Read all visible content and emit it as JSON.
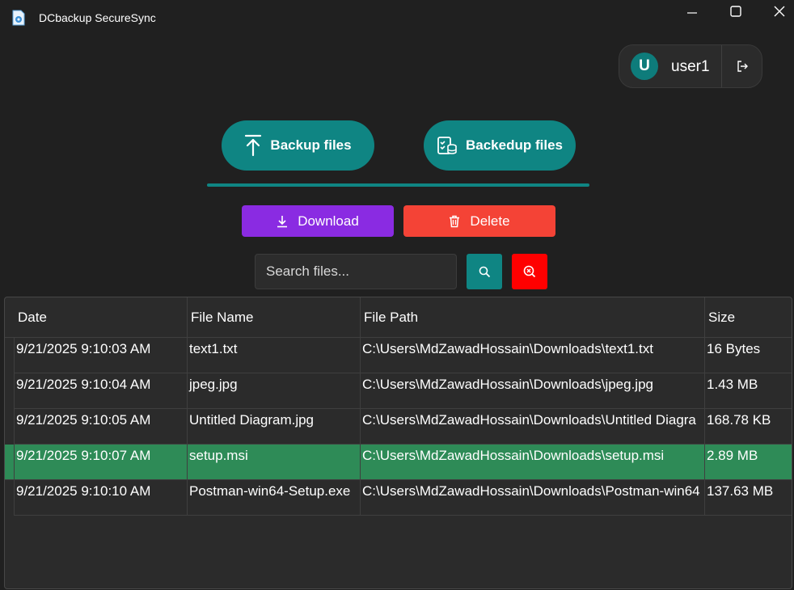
{
  "window": {
    "title": "DCbackup SecureSync"
  },
  "user": {
    "initial": "U",
    "name": "user1"
  },
  "tabs": [
    {
      "label": "Backup files",
      "icon": "upload-arrow-icon"
    },
    {
      "label": "Backedup files",
      "icon": "backed-up-files-icon"
    }
  ],
  "actions": {
    "download_label": "Download",
    "delete_label": "Delete"
  },
  "search": {
    "placeholder": "Search files...",
    "value": ""
  },
  "table": {
    "columns": [
      "Date",
      "File Name",
      "File Path",
      "Size"
    ],
    "rows": [
      {
        "date": "9/21/2025 9:10:03 AM",
        "name": "text1.txt",
        "path": "C:\\Users\\MdZawadHossain\\Downloads\\text1.txt",
        "size": "16 Bytes"
      },
      {
        "date": "9/21/2025 9:10:04 AM",
        "name": "jpeg.jpg",
        "path": "C:\\Users\\MdZawadHossain\\Downloads\\jpeg.jpg",
        "size": "1.43 MB"
      },
      {
        "date": "9/21/2025 9:10:05 AM",
        "name": "Untitled Diagram.jpg",
        "path": "C:\\Users\\MdZawadHossain\\Downloads\\Untitled Diagra",
        "size": "168.78 KB"
      },
      {
        "date": "9/21/2025 9:10:07 AM",
        "name": "setup.msi",
        "path": "C:\\Users\\MdZawadHossain\\Downloads\\setup.msi",
        "size": "2.89 MB"
      },
      {
        "date": "9/21/2025 9:10:10 AM",
        "name": "Postman-win64-Setup.exe",
        "path": "C:\\Users\\MdZawadHossain\\Downloads\\Postman-win64",
        "size": "137.63 MB"
      }
    ],
    "selected_row": 3
  },
  "colors": {
    "background": "#202020",
    "teal": "#0f8583",
    "purple": "#8a2be2",
    "red": "#f44336",
    "clear_red": "#ff0000",
    "selected_row": "#2e8b57"
  }
}
